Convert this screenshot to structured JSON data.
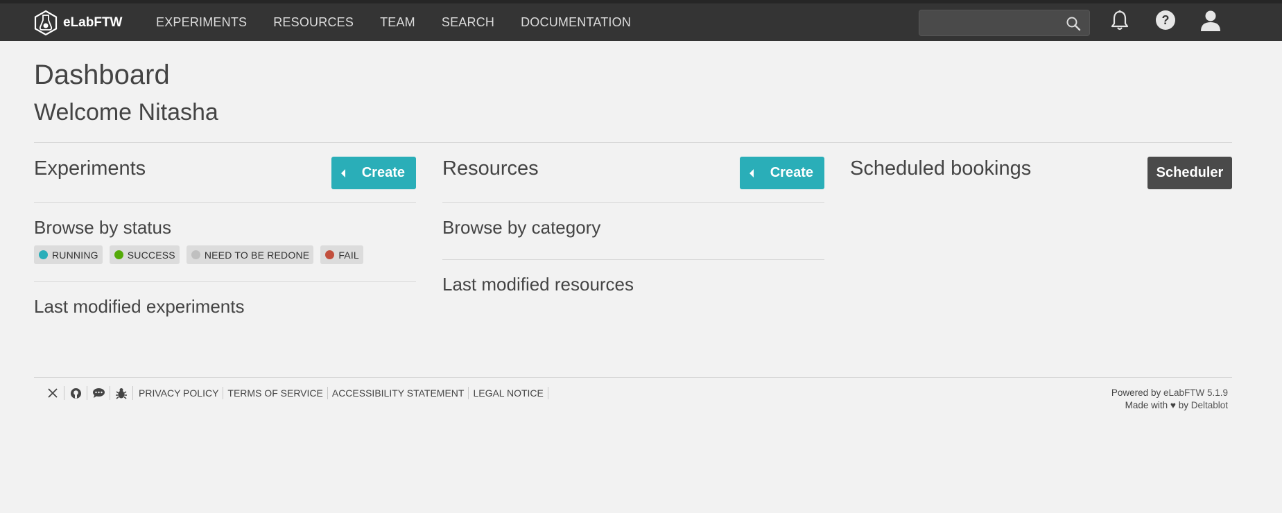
{
  "brand": {
    "name": "eLabFTW"
  },
  "nav": {
    "links": [
      "EXPERIMENTS",
      "RESOURCES",
      "TEAM",
      "SEARCH",
      "DOCUMENTATION"
    ],
    "search_value": ""
  },
  "page": {
    "title": "Dashboard",
    "welcome": "Welcome Nitasha"
  },
  "experiments": {
    "title": "Experiments",
    "create_label": "Create",
    "browse_title": "Browse by status",
    "statuses": [
      {
        "label": "RUNNING",
        "color": "#29aeb9"
      },
      {
        "label": "SUCCESS",
        "color": "#54aa08"
      },
      {
        "label": "NEED TO BE REDONE",
        "color": "#c0c0c0"
      },
      {
        "label": "FAIL",
        "color": "#c24f3d"
      }
    ],
    "last_modified": "Last modified experiments"
  },
  "resources": {
    "title": "Resources",
    "create_label": "Create",
    "browse_title": "Browse by category",
    "last_modified": "Last modified resources"
  },
  "bookings": {
    "title": "Scheduled bookings",
    "scheduler_label": "Scheduler"
  },
  "footer": {
    "links": [
      "PRIVACY POLICY",
      "TERMS OF SERVICE",
      "ACCESSIBILITY STATEMENT",
      "LEGAL NOTICE"
    ],
    "powered_prefix": "Powered by ",
    "powered_link": "eLabFTW 5.1.9",
    "made_with_prefix": "Made with ",
    "heart": "♥",
    "made_with_by": " by ",
    "made_with_link": "Deltablot"
  },
  "colors": {
    "accent": "#2aaeb8",
    "navbar": "#343434",
    "background": "#f2f2f2"
  }
}
